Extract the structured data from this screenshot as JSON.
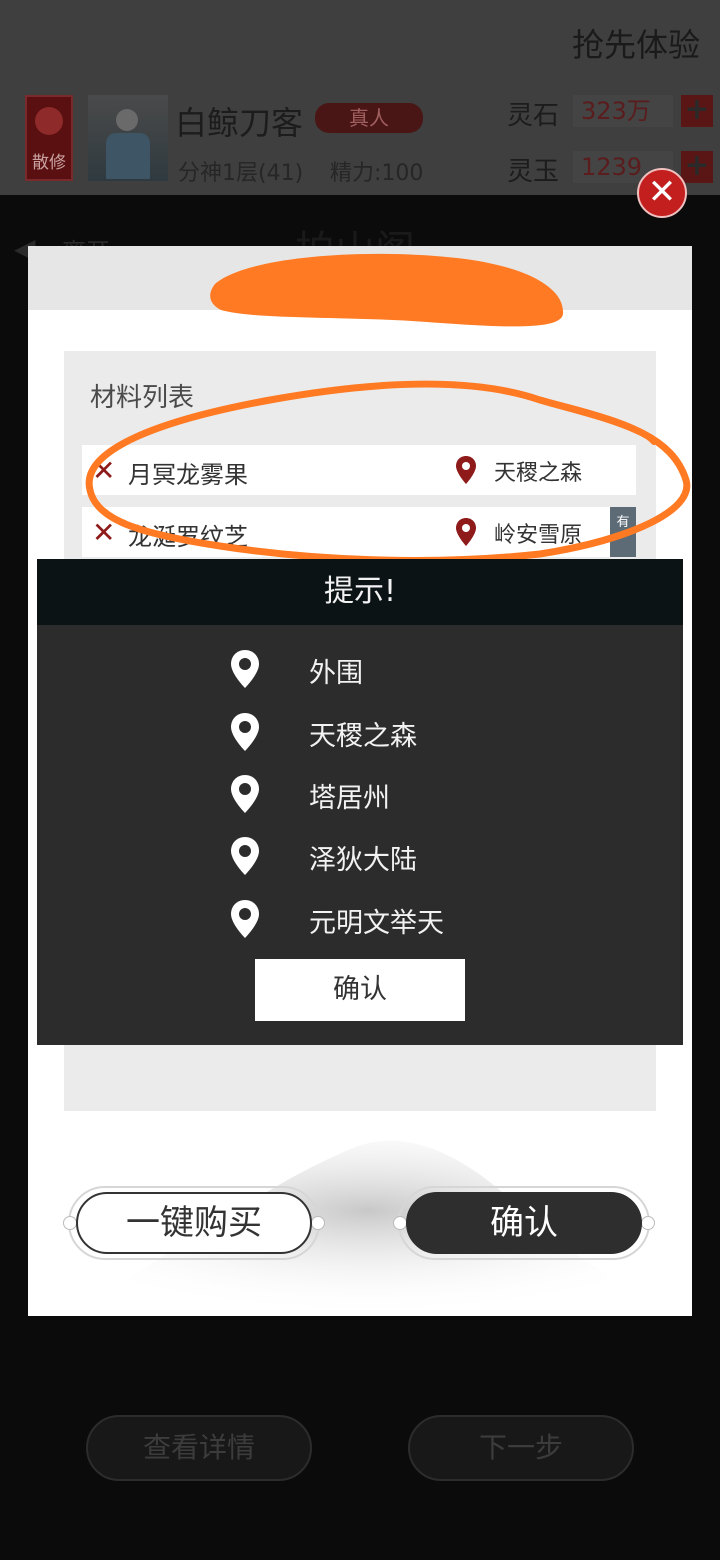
{
  "top_bar": {
    "early_access": "抢先体验",
    "sect_label": "散修",
    "character_name": "白鲸刀客",
    "real_tag": "真人",
    "realm": "分神1层(41)",
    "energy": "精力:100",
    "spirit_stone_label": "灵石",
    "spirit_stone_value": "323万",
    "spirit_jade_label": "灵玉",
    "spirit_jade_value": "1239",
    "plus_symbol": "+"
  },
  "background": {
    "back_label": "离开",
    "title": "拍山阁",
    "view_details": "查看详情",
    "next_step": "下一步"
  },
  "panel": {
    "list_title": "材料列表",
    "materials": [
      {
        "name": "月冥龙雾果",
        "location": "天稷之森",
        "tag": ""
      },
      {
        "name": "龙涎罗纹芝",
        "location": "岭安雪原",
        "tag": "有"
      }
    ],
    "buy_all_label": "一键购买",
    "confirm_label": "确认"
  },
  "dialog": {
    "title": "提示!",
    "locations": [
      "外围",
      "天稷之森",
      "塔居州",
      "泽狄大陆",
      "元明文举天"
    ],
    "confirm_label": "确认"
  },
  "colors": {
    "accent_red": "#8e1a1a",
    "close_red": "#c41f1f",
    "scribble_orange": "#ff7a22",
    "dialog_bg": "#2c2c2c"
  },
  "icons": {
    "close": "close-icon",
    "location": "location-pin-icon",
    "remove": "x-mark-icon",
    "back": "back-arrow-icon"
  }
}
